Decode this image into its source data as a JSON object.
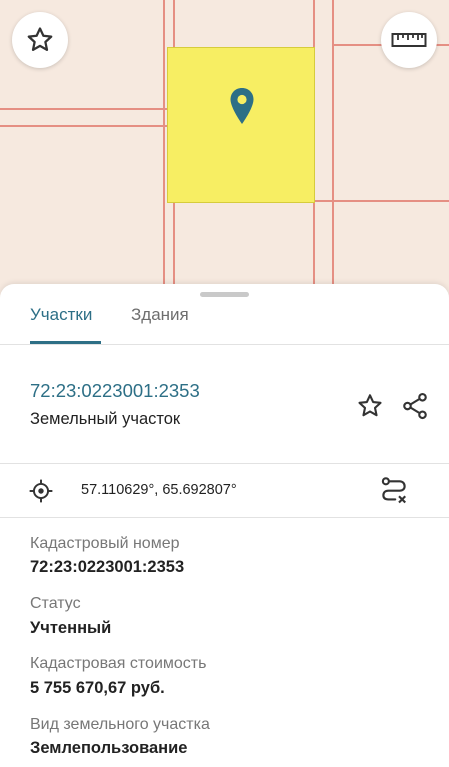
{
  "map": {
    "favorite_icon": "star-outline-icon",
    "ruler_icon": "ruler-icon",
    "pin_icon": "location-pin-icon",
    "parcel_color": "#f7ee63",
    "boundary_color": "#e58f83"
  },
  "tabs": [
    {
      "label": "Участки",
      "active": true
    },
    {
      "label": "Здания",
      "active": false
    }
  ],
  "parcel": {
    "cadastral_number": "72:23:0223001:2353",
    "type": "Земельный участок",
    "coordinates": "57.110629°, 65.692807°"
  },
  "fields": [
    {
      "label": "Кадастровый номер",
      "value": "72:23:0223001:2353"
    },
    {
      "label": "Статус",
      "value": "Учтенный"
    },
    {
      "label": "Кадастровая стоимость",
      "value": "5 755 670,67 руб."
    },
    {
      "label": "Вид земельного участка",
      "value": "Землепользование"
    }
  ],
  "accent_color": "#2d6f86"
}
